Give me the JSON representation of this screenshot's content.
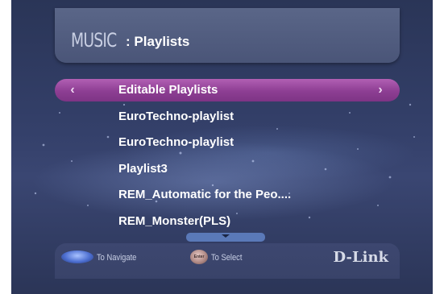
{
  "header": {
    "section": "MUSIC",
    "title": ": Playlists"
  },
  "playlist": {
    "items": [
      {
        "label": "Editable Playlists"
      },
      {
        "label": "EuroTechno-playlist"
      },
      {
        "label": "EuroTechno-playlist"
      },
      {
        "label": "Playlist3"
      },
      {
        "label": "REM_Automatic for the Peo...."
      },
      {
        "label": "REM_Monster(PLS)"
      }
    ],
    "selected_index": 0,
    "left_arrow": "‹",
    "right_arrow": "›"
  },
  "footer": {
    "navigate_hint": "To Navigate",
    "enter_badge": "Enter",
    "select_hint": "To Select",
    "brand": "D-Link"
  },
  "icons": [
    "nav-pad-icon",
    "enter-button-icon",
    "chevron-left-icon",
    "chevron-right-icon",
    "scroll-down-icon"
  ],
  "colors": {
    "selection": "#9a4aa0",
    "background": "#34406a",
    "panel": "#4e597c"
  }
}
